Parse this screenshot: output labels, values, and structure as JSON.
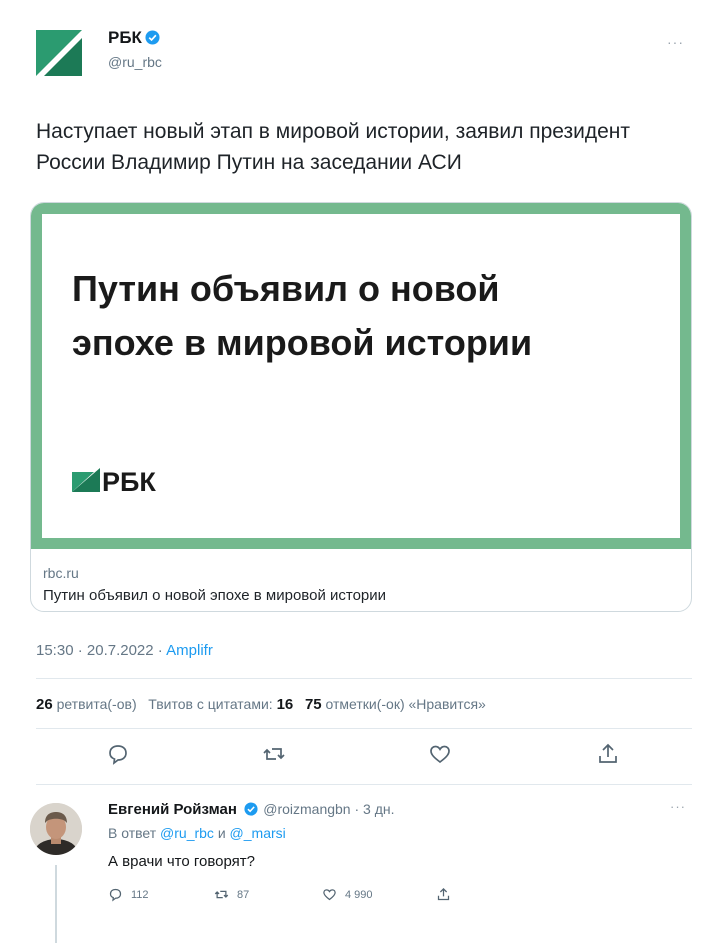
{
  "author": {
    "name": "РБК",
    "handle": "@ru_rbc",
    "more": "···"
  },
  "tweet": {
    "text": "Наступает новый этап в мировой истории, заявил президент России Владимир Путин на заседании АСИ"
  },
  "card": {
    "headline_line1": "Путин объявил о новой",
    "headline_line2": "эпохе в мировой истории",
    "logo_text": "РБК",
    "domain": "rbc.ru",
    "title": "Путин объявил о новой эпохе в мировой истории"
  },
  "meta": {
    "time": "15:30",
    "date": "20.7.2022",
    "source": "Amplifr",
    "separator": "·"
  },
  "stats": {
    "retweets_count": "26",
    "retweets_label": "ретвита(-ов)",
    "quotes_label": "Твитов с цитатами:",
    "quotes_count": "16",
    "likes_count": "75",
    "likes_label": "отметки(-ок) «Нравится»"
  },
  "reply": {
    "name": "Евгений Ройзман",
    "handle_time": "@roizmangbn · 3 дн.",
    "more": "···",
    "reply_prefix": "В ответ",
    "mention1": "@ru_rbc",
    "conj": "и",
    "mention2": "@_marsi",
    "text": "А врачи что говорят?",
    "reply_count": "112",
    "retweet_count": "87",
    "like_count": "4 990"
  },
  "colors": {
    "accent": "#1d9bf0",
    "card_frame": "#74b98e",
    "logo_green": "#1f8f62"
  }
}
